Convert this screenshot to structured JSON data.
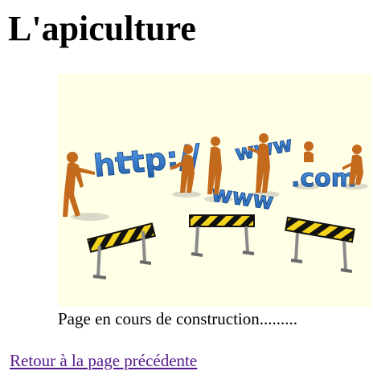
{
  "page": {
    "title": "L'apiculture"
  },
  "illustration": {
    "labels": {
      "http": "http://",
      "www": "www",
      "com": ".com"
    },
    "colors": {
      "background": "#ffffe8",
      "letters": "#2f76c8",
      "figures": "#c46a1c",
      "barrier_stripe": "#f2d21a",
      "barrier_dark": "#111111"
    }
  },
  "caption": "Page en cours de construction.........",
  "back_link": {
    "label": "Retour à la page précédente",
    "color": "#551a8b"
  }
}
